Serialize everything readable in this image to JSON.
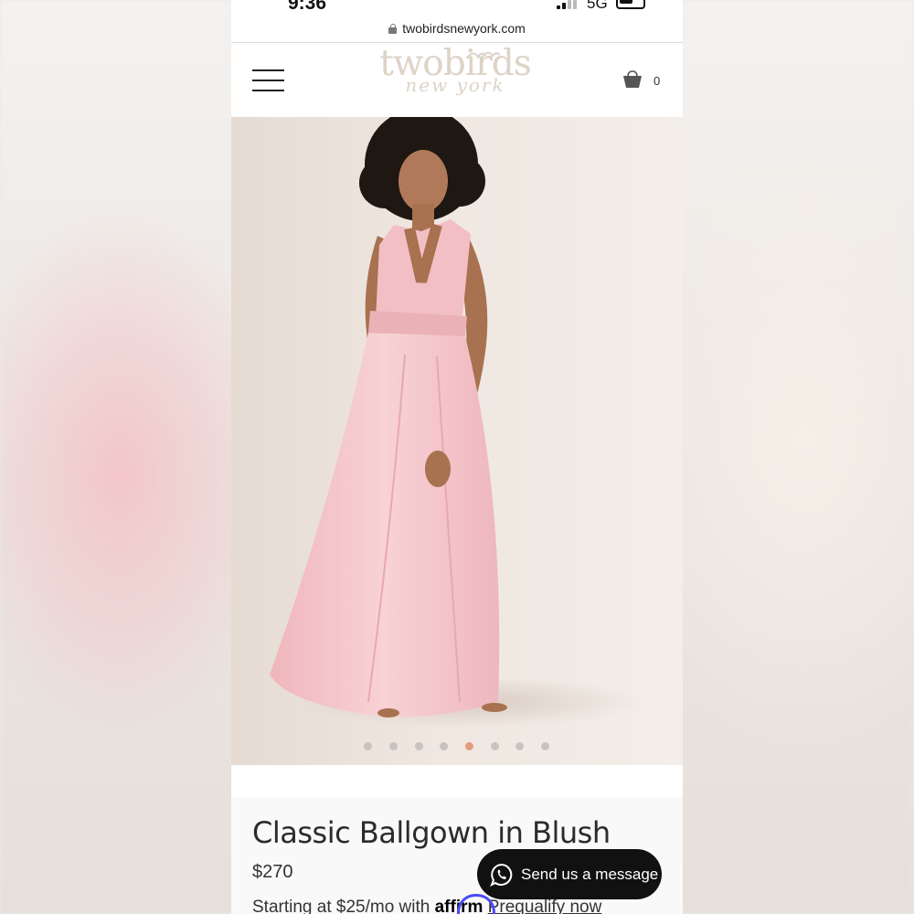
{
  "status_bar": {
    "time": "9:36",
    "network": "5G"
  },
  "browser": {
    "url": "twobirdsnewyork.com"
  },
  "header": {
    "logo_text": "twobirds",
    "logo_subtext": "new york",
    "cart_count": "0"
  },
  "gallery": {
    "image_count": 8,
    "active_index": 4
  },
  "product": {
    "title": "Classic Ballgown in Blush",
    "price": "$270",
    "financing_prefix": "Starting at $25/mo with",
    "financing_brand": "affirm",
    "financing_link": "Prequalify now"
  },
  "chat": {
    "label": "Send us a message"
  },
  "colors": {
    "dress": "#f4c4c8",
    "active_dot": "#e39a80",
    "affirm_blue": "#4a4af4",
    "logo": "#ddd3c6"
  },
  "icons": [
    "lock-icon",
    "hamburger-menu-icon",
    "shopping-bag-icon",
    "whatsapp-icon"
  ]
}
